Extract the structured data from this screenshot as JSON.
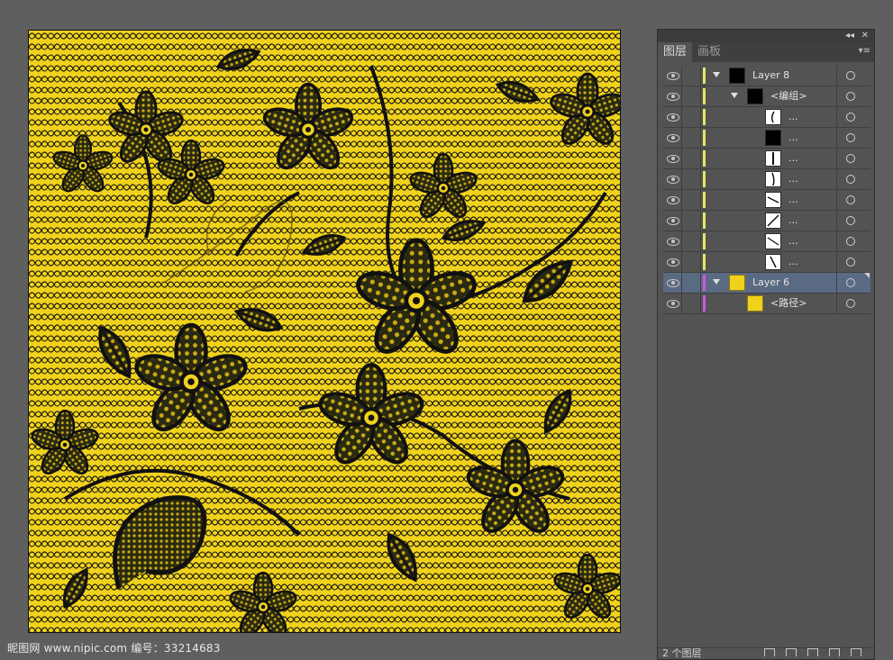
{
  "colors": {
    "background": "#5f5f5f",
    "artboard_yellow": "#f0d21c",
    "lace_black": "#151515",
    "layer8_color": "#e6e36a",
    "layer6_color": "#c85ae0",
    "selected_row": "#5a6a82"
  },
  "panel": {
    "tabs": [
      {
        "label": "图层",
        "active": true
      },
      {
        "label": "画板",
        "active": false
      }
    ],
    "rows": [
      {
        "label": "Layer 8",
        "thumb": "black",
        "expanded": true,
        "selected": false,
        "bar": "layer8"
      },
      {
        "label": "<编组>",
        "thumb": "black",
        "expanded": true,
        "selected": false,
        "bar": "layer8"
      },
      {
        "label": "...",
        "thumb": "curve",
        "expanded": false,
        "selected": false,
        "bar": "layer8"
      },
      {
        "label": "...",
        "thumb": "black",
        "expanded": false,
        "selected": false,
        "bar": "layer8"
      },
      {
        "label": "...",
        "thumb": "vertical",
        "expanded": false,
        "selected": false,
        "bar": "layer8"
      },
      {
        "label": "...",
        "thumb": "curve2",
        "expanded": false,
        "selected": false,
        "bar": "layer8"
      },
      {
        "label": "...",
        "thumb": "slash",
        "expanded": false,
        "selected": false,
        "bar": "layer8"
      },
      {
        "label": "...",
        "thumb": "diag",
        "expanded": false,
        "selected": false,
        "bar": "layer8"
      },
      {
        "label": "...",
        "thumb": "slash2",
        "expanded": false,
        "selected": false,
        "bar": "layer8"
      },
      {
        "label": "...",
        "thumb": "back",
        "expanded": false,
        "selected": false,
        "bar": "layer8"
      },
      {
        "label": "Layer 6",
        "thumb": "yellow",
        "expanded": true,
        "selected": true,
        "bar": "layer6"
      },
      {
        "label": "<路径>",
        "thumb": "yellow",
        "expanded": false,
        "selected": false,
        "bar": "layer6"
      }
    ],
    "footer": {
      "layer_count": "2 个图层"
    }
  },
  "watermark": "昵图网 www.nipic.com    编号：33214683"
}
